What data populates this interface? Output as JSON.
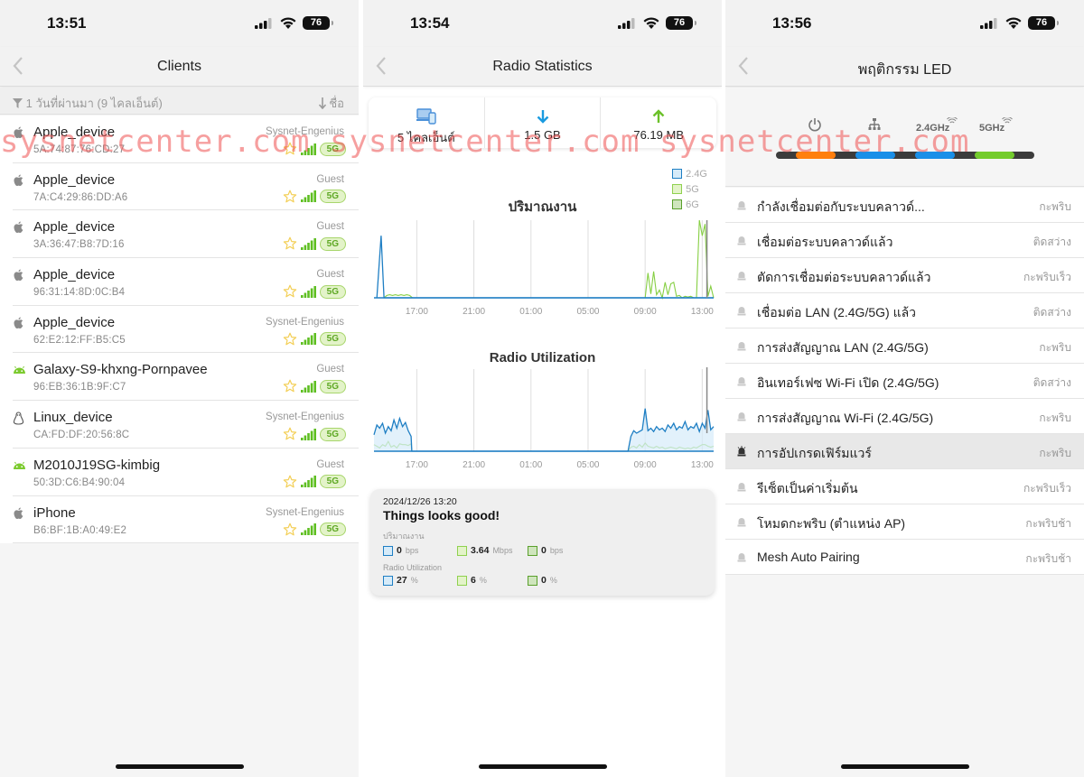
{
  "panels": [
    {
      "status": {
        "time": "13:51",
        "battery": "76"
      },
      "nav": {
        "title": "Clients",
        "back_icon": "chevron-left-icon"
      },
      "filter": {
        "label": "1 วันที่ผ่านมา (9 ไคลเอ็นต์)",
        "sort_label": "ชื่อ"
      },
      "clients": [
        {
          "os": "apple",
          "name": "Apple_device",
          "mac": "5A:74:87:76:CD:27",
          "ssid": "Sysnet-Engenius",
          "band": "5G"
        },
        {
          "os": "apple",
          "name": "Apple_device",
          "mac": "7A:C4:29:86:DD:A6",
          "ssid": "Guest",
          "band": "5G"
        },
        {
          "os": "apple",
          "name": "Apple_device",
          "mac": "3A:36:47:B8:7D:16",
          "ssid": "Guest",
          "band": "5G"
        },
        {
          "os": "apple",
          "name": "Apple_device",
          "mac": "96:31:14:8D:0C:B4",
          "ssid": "Guest",
          "band": "5G"
        },
        {
          "os": "apple",
          "name": "Apple_device",
          "mac": "62:E2:12:FF:B5:C5",
          "ssid": "Sysnet-Engenius",
          "band": "5G"
        },
        {
          "os": "android",
          "name": "Galaxy-S9-khxng-Pornpavee",
          "mac": "96:EB:36:1B:9F:C7",
          "ssid": "Guest",
          "band": "5G"
        },
        {
          "os": "linux",
          "name": "Linux_device",
          "mac": "CA:FD:DF:20:56:8C",
          "ssid": "Sysnet-Engenius",
          "band": "5G"
        },
        {
          "os": "android",
          "name": "M2010J19SG-kimbig",
          "mac": "50:3D:C6:B4:90:04",
          "ssid": "Guest",
          "band": "5G"
        },
        {
          "os": "apple",
          "name": "iPhone",
          "mac": "B6:BF:1B:A0:49:E2",
          "ssid": "Sysnet-Engenius",
          "band": "5G"
        }
      ]
    },
    {
      "status": {
        "time": "13:54",
        "battery": "76"
      },
      "nav": {
        "title": "Radio Statistics",
        "back_icon": "chevron-left-icon"
      },
      "summary": [
        {
          "icon": "devices-icon",
          "value": "5 ไคลเอ็นต์",
          "color": "#4a90d9"
        },
        {
          "icon": "download-arrow-icon",
          "value": "1.5 GB",
          "color": "#1a9be0"
        },
        {
          "icon": "upload-arrow-icon",
          "value": "76.19 MB",
          "color": "#6cc12a"
        }
      ],
      "legend": [
        {
          "label": "2.4G",
          "color": "#1f7fc4",
          "fill": "#d6ebf9"
        },
        {
          "label": "5G",
          "color": "#8fd14f",
          "fill": "#e3f3c9"
        },
        {
          "label": "6G",
          "color": "#5aa02c",
          "fill": "#cfe5bd"
        }
      ],
      "tooltip": {
        "timestamp": "2024/12/26 13:20",
        "message": "Things looks good!",
        "throughput_label": "ปริมาณงาน",
        "throughput": [
          {
            "value": "0",
            "unit": "bps"
          },
          {
            "value": "3.64",
            "unit": "Mbps"
          },
          {
            "value": "0",
            "unit": "bps"
          }
        ],
        "util_label": "Radio Utilization",
        "utilization": [
          {
            "value": "27",
            "unit": "%"
          },
          {
            "value": "6",
            "unit": "%"
          },
          {
            "value": "0",
            "unit": "%"
          }
        ]
      }
    },
    {
      "status": {
        "time": "13:56",
        "battery": "76"
      },
      "nav": {
        "title": "พฤติกรรม LED",
        "back_icon": "chevron-left-icon"
      },
      "led_indicators": [
        {
          "icon": "power-icon",
          "label": "",
          "color": "#ff7f0e"
        },
        {
          "icon": "network-icon",
          "label": "",
          "color": "#1a8fe8"
        },
        {
          "icon": "wifi-icon",
          "label": "2.4GHz",
          "color": "#1a8fe8"
        },
        {
          "icon": "wifi-icon",
          "label": "5GHz",
          "color": "#74cc2e"
        }
      ],
      "led_items": [
        {
          "label": "กำลังเชื่อมต่อกับระบบคลาวด์...",
          "state": "กะพริบ",
          "active": false
        },
        {
          "label": "เชื่อมต่อระบบคลาวด์แล้ว",
          "state": "ติดสว่าง",
          "active": false
        },
        {
          "label": "ตัดการเชื่อมต่อระบบคลาวด์แล้ว",
          "state": "กะพริบเร็ว",
          "active": false
        },
        {
          "label": "เชื่อมต่อ LAN (2.4G/5G) แล้ว",
          "state": "ติดสว่าง",
          "active": false
        },
        {
          "label": "การส่งสัญญาณ LAN (2.4G/5G)",
          "state": "กะพริบ",
          "active": false
        },
        {
          "label": "อินเทอร์เฟซ Wi-Fi เปิด (2.4G/5G)",
          "state": "ติดสว่าง",
          "active": false
        },
        {
          "label": "การส่งสัญญาณ Wi-Fi (2.4G/5G)",
          "state": "กะพริบ",
          "active": false
        },
        {
          "label": "การอัปเกรดเฟิร์มแวร์",
          "state": "กะพริบ",
          "active": true
        },
        {
          "label": "รีเซ็ตเป็นค่าเริ่มต้น",
          "state": "กะพริบเร็ว",
          "active": false
        },
        {
          "label": "โหมดกะพริบ (ตำแหน่ง AP)",
          "state": "กะพริบช้า",
          "active": false
        },
        {
          "label": "Mesh Auto Pairing",
          "state": "กะพริบช้า",
          "active": false
        }
      ]
    }
  ],
  "watermark": "sysnetcenter.com  sysnetcenter.com  sysnetcenter.com",
  "chart_data": [
    {
      "type": "line",
      "title": "ปริมาณงาน",
      "xlabel": "",
      "ylabel": "",
      "x_ticks": [
        "17:00",
        "21:00",
        "01:00",
        "05:00",
        "09:00",
        "13:00"
      ],
      "x_range_hours": [
        14.0,
        13.8
      ],
      "y_range": [
        0,
        100
      ],
      "grid": "vertical",
      "legend_position": "top-right",
      "x": [
        14.2,
        14.5,
        14.7,
        14.9,
        15.1,
        15.3,
        15.5,
        15.7,
        15.9,
        16.1,
        16.3,
        16.5,
        16.7,
        17.0,
        21.0,
        1.0,
        5.0,
        8.8,
        9.0,
        9.2,
        9.4,
        9.6,
        9.8,
        10.0,
        10.2,
        10.4,
        10.6,
        10.8,
        11.0,
        11.2,
        11.4,
        11.6,
        11.8,
        12.0,
        12.2,
        12.4,
        12.6,
        12.8,
        13.0,
        13.2,
        13.4,
        13.6,
        13.8
      ],
      "series": [
        {
          "name": "2.4G",
          "values": [
            0,
            80,
            0,
            0,
            0,
            0,
            0,
            0,
            0,
            0,
            0,
            0,
            0,
            0,
            0,
            0,
            0,
            0,
            0,
            0,
            0,
            0,
            0,
            0,
            0,
            0,
            0,
            0,
            0,
            0,
            0,
            0,
            0,
            0,
            0,
            0,
            0,
            0,
            0,
            0,
            0,
            0,
            0
          ]
        },
        {
          "name": "5G",
          "values": [
            0,
            0,
            0,
            3,
            4,
            3,
            4,
            3,
            4,
            3,
            4,
            3,
            0,
            0,
            0,
            0,
            0,
            0,
            0,
            32,
            5,
            34,
            4,
            10,
            0,
            20,
            4,
            18,
            20,
            2,
            3,
            0,
            2,
            1,
            2,
            0,
            0,
            100,
            80,
            95,
            2,
            15,
            0
          ]
        },
        {
          "name": "6G",
          "values": [
            0,
            0,
            0,
            0,
            0,
            0,
            0,
            0,
            0,
            0,
            0,
            0,
            0,
            0,
            0,
            0,
            0,
            0,
            0,
            0,
            0,
            0,
            0,
            0,
            0,
            0,
            0,
            0,
            0,
            0,
            0,
            0,
            0,
            0,
            0,
            0,
            0,
            0,
            0,
            0,
            0,
            0,
            0
          ]
        }
      ]
    },
    {
      "type": "area",
      "title": "Radio Utilization",
      "xlabel": "",
      "ylabel": "",
      "x_ticks": [
        "17:00",
        "21:00",
        "01:00",
        "05:00",
        "09:00",
        "13:00"
      ],
      "x_range_hours": [
        14.0,
        13.8
      ],
      "y_range": [
        0,
        100
      ],
      "grid": "vertical",
      "x": [
        14.0,
        14.2,
        14.4,
        14.6,
        14.8,
        15.0,
        15.2,
        15.4,
        15.6,
        15.8,
        16.0,
        16.2,
        16.4,
        16.6,
        16.65,
        17.0,
        21.0,
        1.0,
        5.0,
        7.8,
        8.0,
        8.2,
        8.4,
        8.6,
        8.8,
        9.0,
        9.2,
        9.4,
        9.6,
        9.8,
        10.0,
        10.2,
        10.4,
        10.6,
        10.8,
        11.0,
        11.2,
        11.4,
        11.6,
        11.8,
        12.0,
        12.2,
        12.4,
        12.6,
        12.8,
        13.0,
        13.2,
        13.4,
        13.6,
        13.8
      ],
      "series": [
        {
          "name": "2.4G",
          "values": [
            20,
            32,
            28,
            34,
            22,
            30,
            25,
            38,
            28,
            40,
            30,
            35,
            25,
            18,
            0,
            0,
            0,
            0,
            0,
            0,
            18,
            25,
            22,
            24,
            26,
            52,
            25,
            28,
            24,
            30,
            26,
            28,
            24,
            32,
            28,
            34,
            26,
            30,
            28,
            36,
            26,
            30,
            28,
            34,
            24,
            34,
            28,
            50,
            26,
            30
          ]
        },
        {
          "name": "5G",
          "values": [
            8,
            6,
            4,
            8,
            6,
            12,
            5,
            7,
            4,
            9,
            8,
            8,
            7,
            9,
            0,
            0,
            0,
            0,
            0,
            0,
            5,
            6,
            4,
            8,
            5,
            10,
            6,
            5,
            4,
            6,
            4,
            5,
            3,
            4,
            5,
            4,
            3,
            5,
            4,
            3,
            4,
            3,
            5,
            4,
            6,
            8,
            8,
            6,
            5,
            6
          ]
        },
        {
          "name": "6G",
          "values": [
            0,
            0,
            0,
            0,
            0,
            0,
            0,
            0,
            0,
            0,
            0,
            0,
            0,
            0,
            0,
            0,
            0,
            0,
            0,
            0,
            0,
            0,
            0,
            0,
            0,
            0,
            0,
            0,
            0,
            0,
            0,
            0,
            0,
            0,
            0,
            0,
            0,
            0,
            0,
            0,
            0,
            0,
            0,
            0,
            0,
            0,
            0,
            0,
            0,
            0
          ]
        }
      ]
    }
  ]
}
